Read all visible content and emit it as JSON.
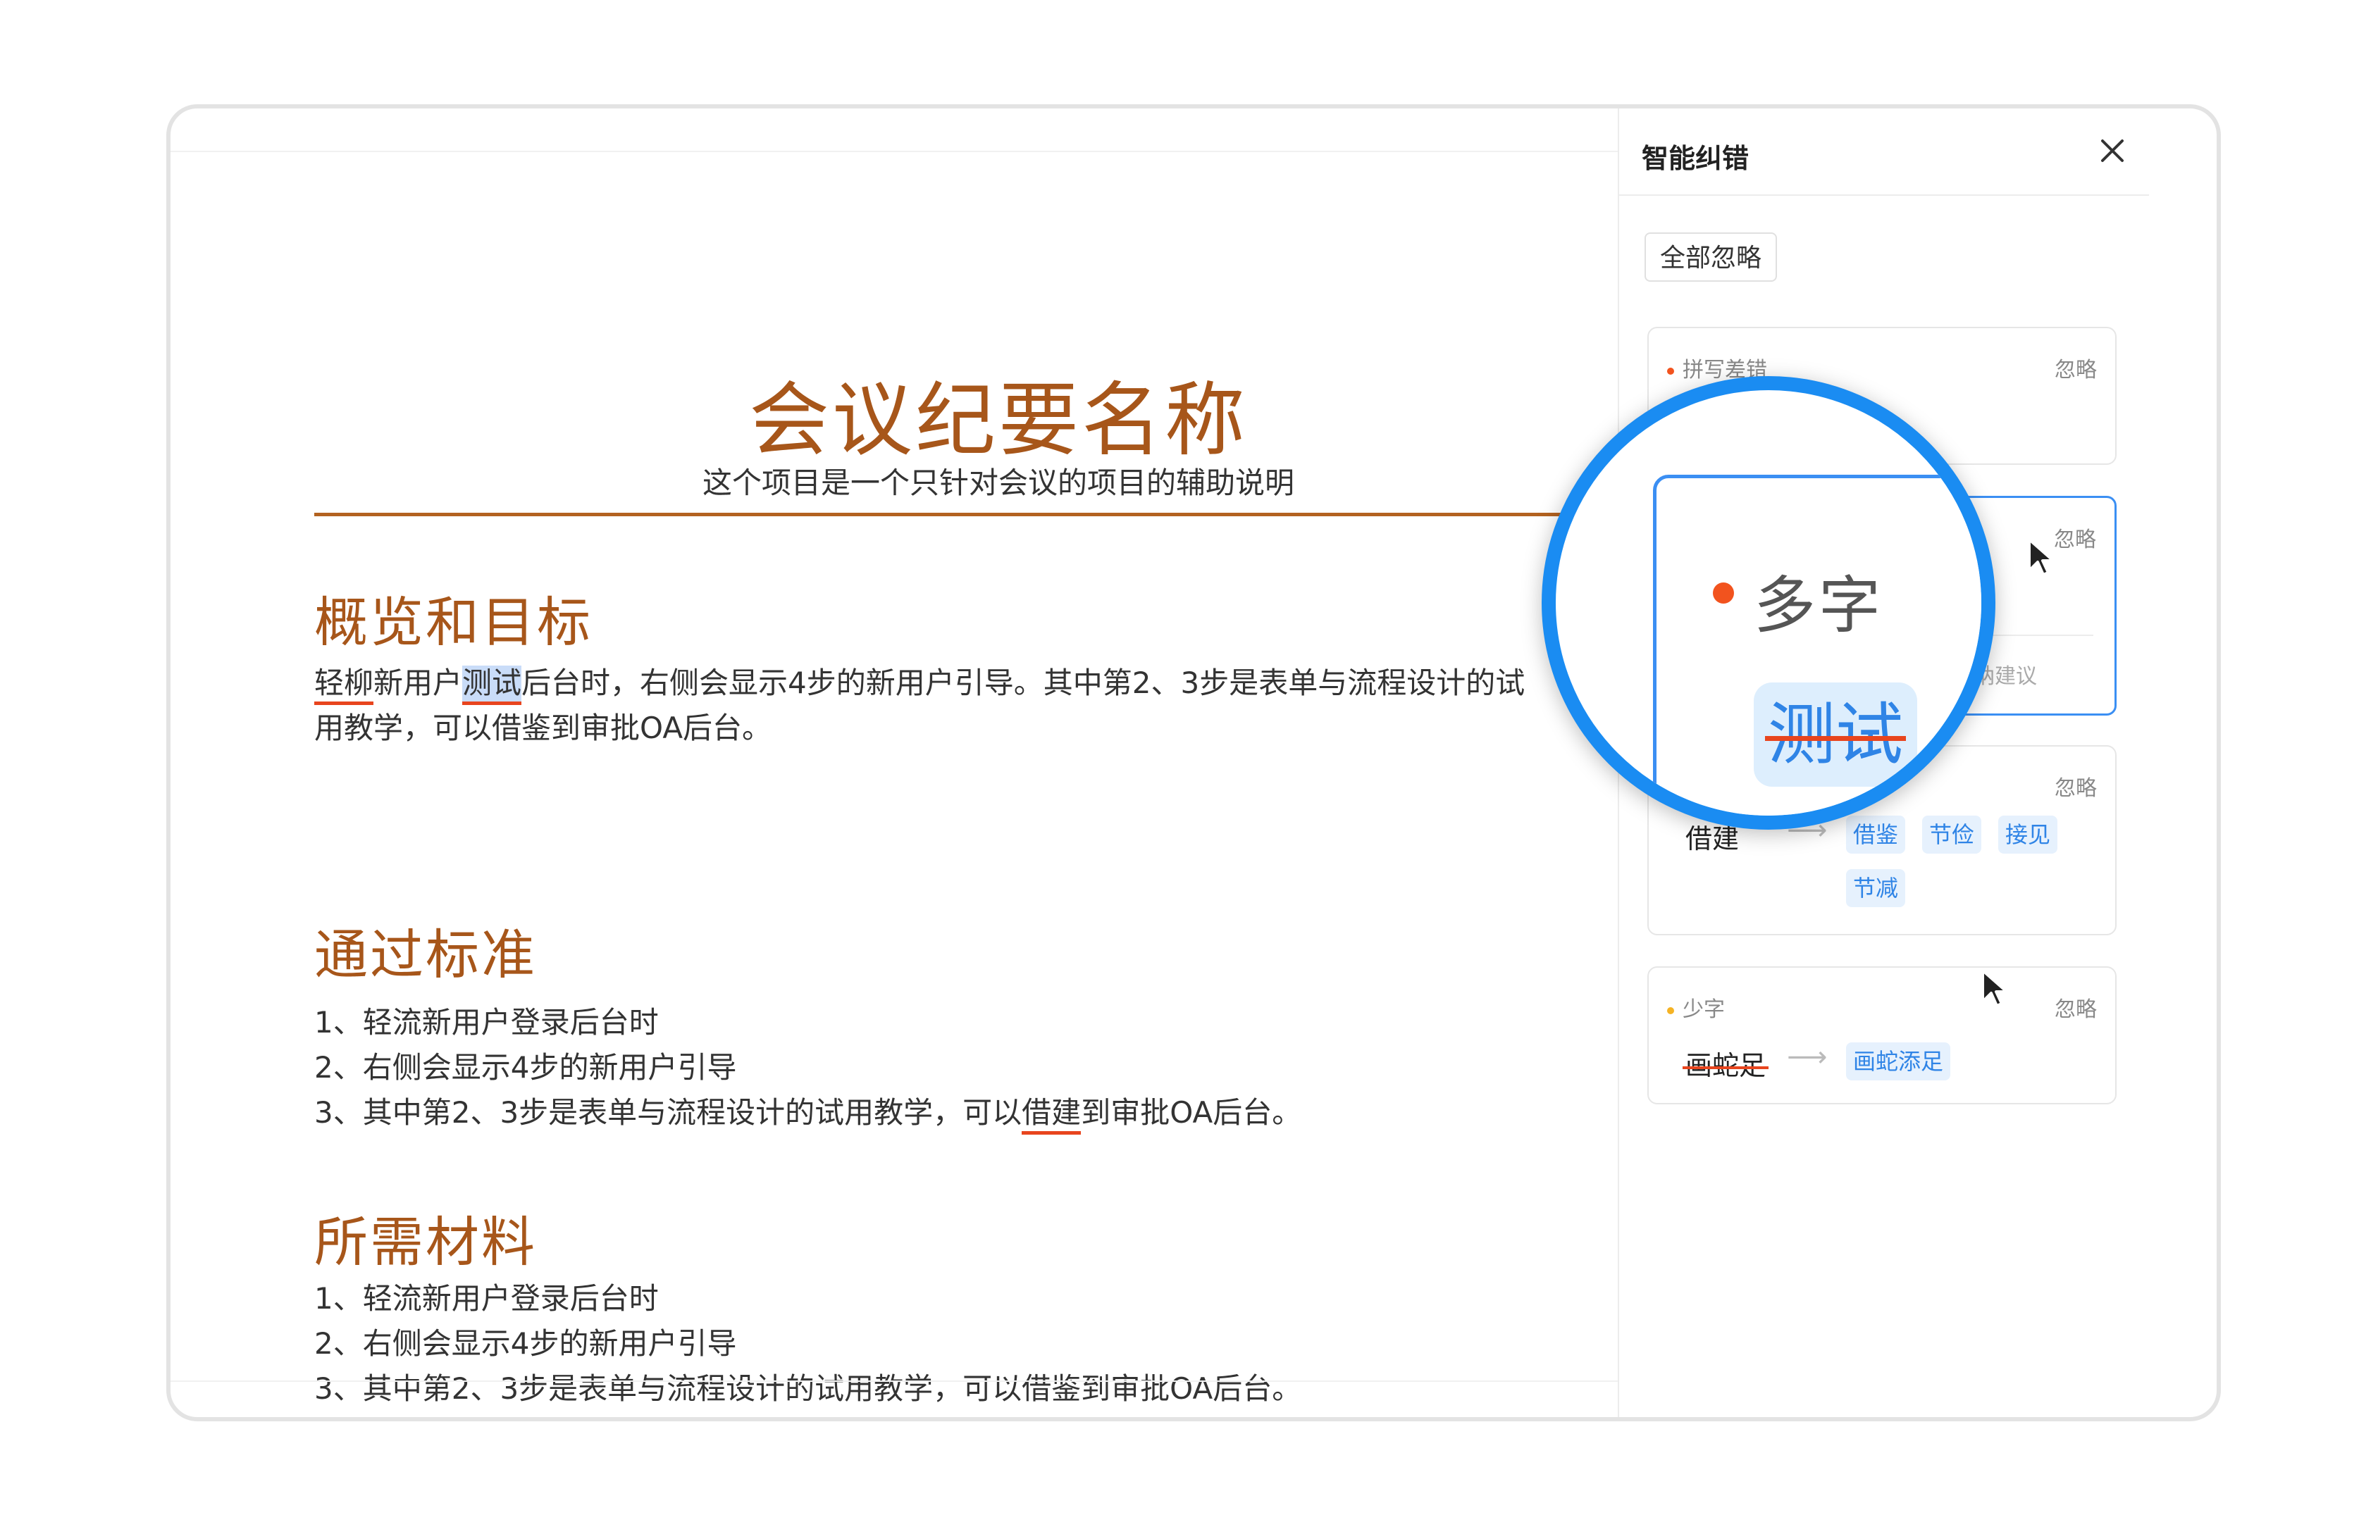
{
  "document": {
    "title": "会议纪要名称",
    "subtitle": "这个项目是一个只针对会议的项目的辅助说明",
    "sections": [
      {
        "heading": "概览和目标",
        "para_line1": {
          "err1": "轻柳",
          "t1": "新用户",
          "err2": "测试",
          "t2": "后台时，右侧会显示4步的新用户引导。其中第2、3步是表单与流程设计的试"
        },
        "para_line2": "用教学，可以借鉴到审批OA后台。"
      },
      {
        "heading": "通过标准",
        "items": [
          "1、轻流新用户登录后台时",
          "2、右侧会显示4步的新用户引导"
        ],
        "item3": {
          "pre": "3、其中第2、3步是表单与流程设计的试用教学，可以",
          "err": "借建",
          "post": "到审批OA后台。"
        }
      },
      {
        "heading": "所需材料",
        "items": [
          "1、轻流新用户登录后台时",
          "2、右侧会显示4步的新用户引导",
          "3、其中第2、3步是表单与流程设计的试用教学，可以借鉴到审批OA后台。"
        ]
      }
    ]
  },
  "panel": {
    "title": "智能纠错",
    "close_icon": "close-icon",
    "ignore_all": "全部忽略",
    "ignore": "忽略",
    "cards": [
      {
        "category": "拼写差错",
        "dot_color": "#f2531e"
      },
      {
        "category": "多字",
        "dot_color": "#f2531e",
        "suggestion": "测试",
        "hint": "采纳建议"
      },
      {
        "category": "",
        "word": "借建",
        "suggestions": [
          "借鉴",
          "节俭",
          "接见",
          "节减"
        ]
      },
      {
        "category": "少字",
        "dot_color": "#f5b324",
        "word": "画蛇足",
        "suggestion": "画蛇添足"
      }
    ]
  },
  "magnifier": {
    "category": "多字",
    "suggestion": "测试"
  },
  "colors": {
    "accent": "#a7561a",
    "error": "#e8451e",
    "primary": "#1a8cf2"
  }
}
